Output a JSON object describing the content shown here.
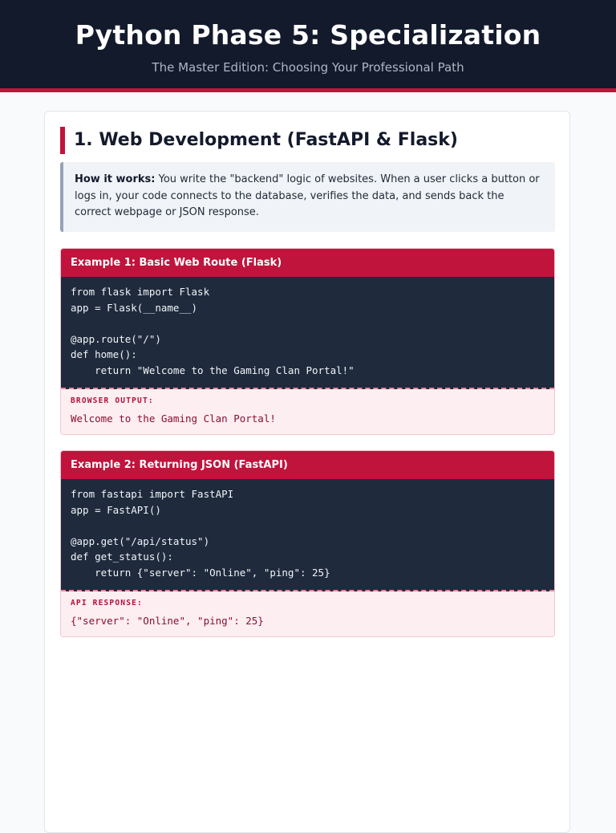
{
  "header": {
    "title": "Python Phase 5: Specialization",
    "subtitle": "The Master Edition: Choosing Your Professional Path"
  },
  "section": {
    "title": "1. Web Development (FastAPI & Flask)",
    "info_label": "How it works:",
    "info_text": " You write the \"backend\" logic of websites. When a user clicks a button or logs in, your code connects to the database, verifies the data, and sends back the correct webpage or JSON response."
  },
  "examples": [
    {
      "title": "Example 1: Basic Web Route (Flask)",
      "code": [
        "from flask import Flask",
        "app = Flask(__name__)",
        "",
        "@app.route(\"/\")",
        "def home():",
        "    return \"Welcome to the Gaming Clan Portal!\""
      ],
      "output_label": "BROWSER OUTPUT:",
      "output_value": "Welcome to the Gaming Clan Portal!"
    },
    {
      "title": "Example 2: Returning JSON (FastAPI)",
      "code": [
        "from fastapi import FastAPI",
        "app = FastAPI()",
        "",
        "@app.get(\"/api/status\")",
        "def get_status():",
        "    return {\"server\": \"Online\", \"ping\": 25}"
      ],
      "output_label": "API RESPONSE:",
      "output_value": "{\"server\": \"Online\", \"ping\": 25}"
    }
  ],
  "colors": {
    "header_bg": "#131a2c",
    "accent": "#c0143c",
    "code_bg": "#1f2a3c",
    "output_bg": "#fdeef1"
  }
}
